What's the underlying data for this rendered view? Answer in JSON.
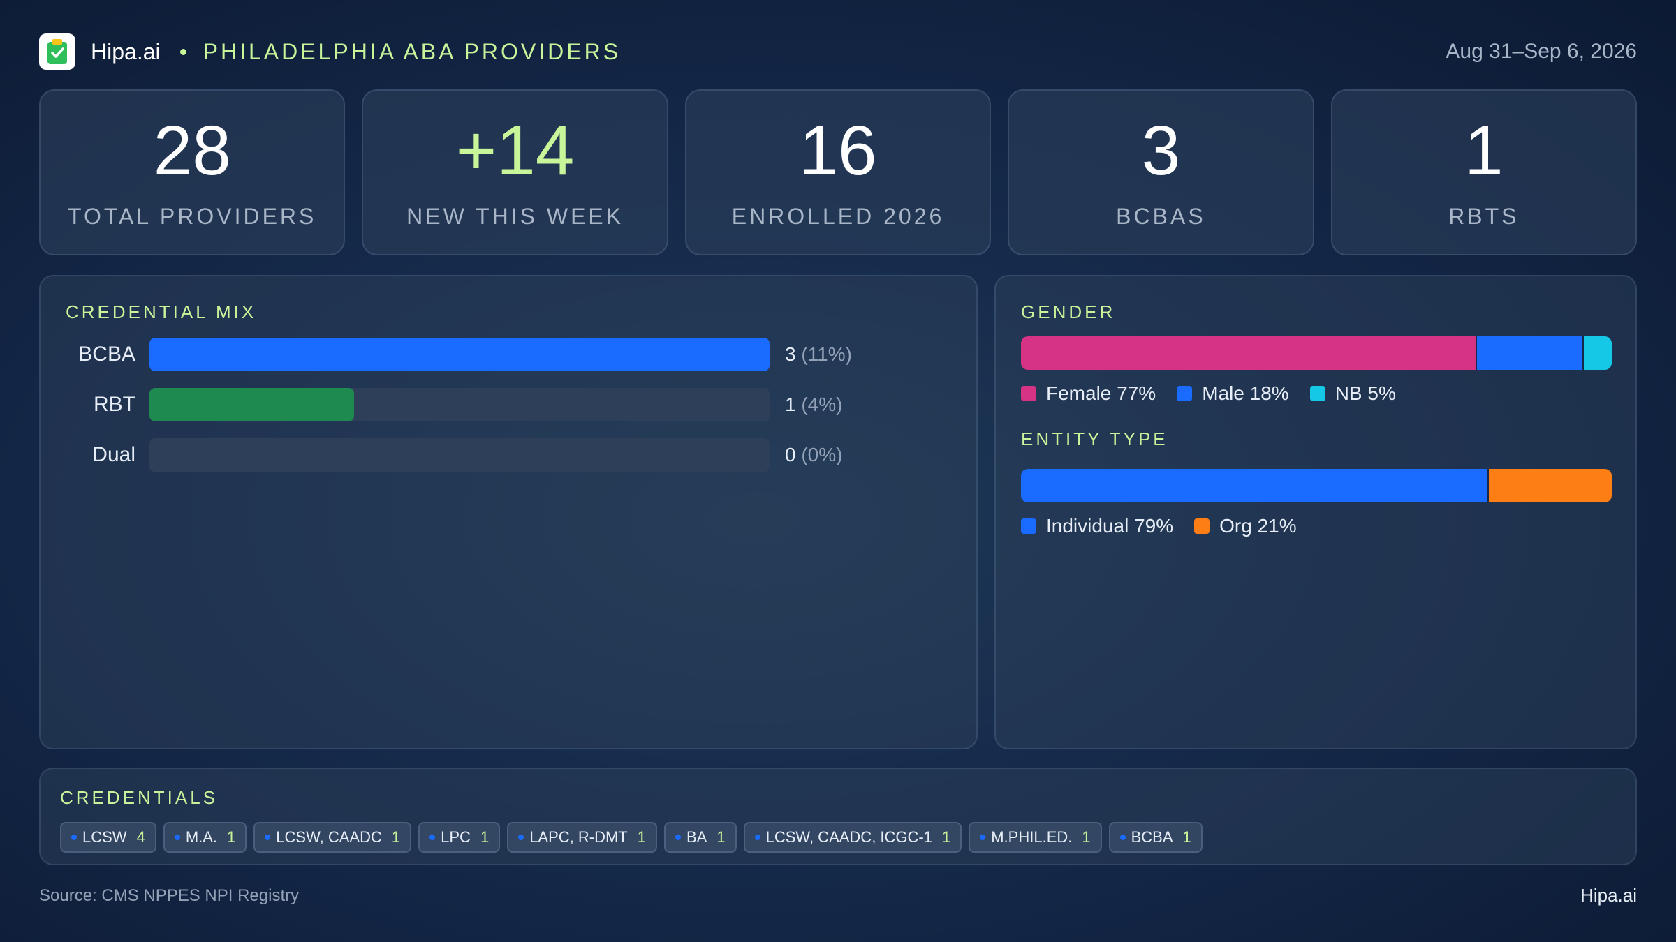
{
  "header": {
    "brand": "Hipa.ai",
    "region": "PHILADELPHIA  ABA  PROVIDERS",
    "date_range": "Aug 31–Sep 6, 2026",
    "logo_icon": "clipboard-check-icon"
  },
  "stats": [
    {
      "value": "28",
      "label": "TOTAL  PROVIDERS"
    },
    {
      "value": "+14",
      "label": "NEW  THIS  WEEK",
      "accent": true
    },
    {
      "value": "16",
      "label": "ENROLLED  2026"
    },
    {
      "value": "3",
      "label": "BCBAS"
    },
    {
      "value": "1",
      "label": "RBTS"
    }
  ],
  "credential_mix": {
    "title": "CREDENTIAL  MIX",
    "rows": [
      {
        "label": "BCBA",
        "count": "3",
        "pct": "(11%)",
        "color": "#1a6bff",
        "fill_fraction": 1.0
      },
      {
        "label": "RBT",
        "count": "1",
        "pct": "(4%)",
        "color": "#1e8a4f",
        "fill_fraction": 0.33
      },
      {
        "label": "Dual",
        "count": "0",
        "pct": "(0%)",
        "color": "#2e4059",
        "fill_fraction": 0.0
      }
    ]
  },
  "gender": {
    "title": "GENDER",
    "segments": [
      {
        "label": "Female 77%",
        "value": 77,
        "color": "#d63384"
      },
      {
        "label": "Male 18%",
        "value": 18,
        "color": "#1a6bff"
      },
      {
        "label": "NB 5%",
        "value": 5,
        "color": "#14c8e6"
      }
    ]
  },
  "entity_type": {
    "title": "ENTITY  TYPE",
    "segments": [
      {
        "label": "Individual 79%",
        "value": 79,
        "color": "#1a6bff"
      },
      {
        "label": "Org 21%",
        "value": 21,
        "color": "#fd7e14"
      }
    ]
  },
  "credentials": {
    "title": "CREDENTIALS",
    "chips": [
      {
        "name": "LCSW",
        "count": "4"
      },
      {
        "name": "M.A.",
        "count": "1"
      },
      {
        "name": "LCSW, CAADC",
        "count": "1"
      },
      {
        "name": "LPC",
        "count": "1"
      },
      {
        "name": "LAPC, R-DMT",
        "count": "1"
      },
      {
        "name": "BA",
        "count": "1"
      },
      {
        "name": "LCSW, CAADC, ICGC-1",
        "count": "1"
      },
      {
        "name": "M.PHIL.ED.",
        "count": "1"
      },
      {
        "name": "BCBA",
        "count": "1"
      }
    ]
  },
  "footer": {
    "source": "Source: CMS NPPES NPI Registry",
    "brand": "Hipa.ai"
  }
}
